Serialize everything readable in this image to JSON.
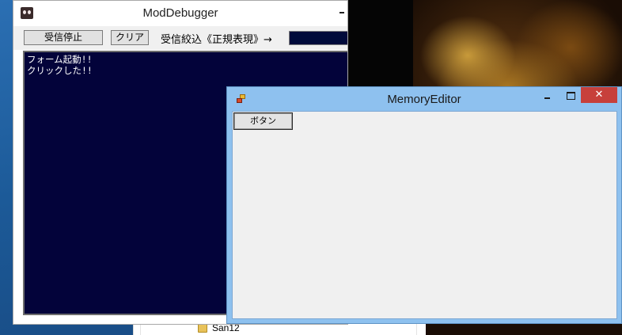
{
  "desktop": {
    "explorer_folder_label": "San12"
  },
  "mod_debugger": {
    "title": "ModDebugger",
    "stop_receive_label": "受信停止",
    "clear_label": "クリア",
    "filter_label": "受信絞込《正規表現》→",
    "filter_value": "",
    "log_lines": [
      "フォーム起動!!",
      "クリックした!!"
    ]
  },
  "memory_editor": {
    "title": "MemoryEditor",
    "button_label": "ボタン",
    "close_glyph": "✕"
  },
  "colors": {
    "log_background": "#03033a",
    "log_text": "#ffffff",
    "memory_editor_frame": "#8ec1ef",
    "close_button": "#c7403b"
  },
  "icons": [
    "mod-debugger-app-icon",
    "memory-editor-app-icon",
    "folder-icon",
    "minimize-icon",
    "maximize-icon",
    "close-icon"
  ]
}
